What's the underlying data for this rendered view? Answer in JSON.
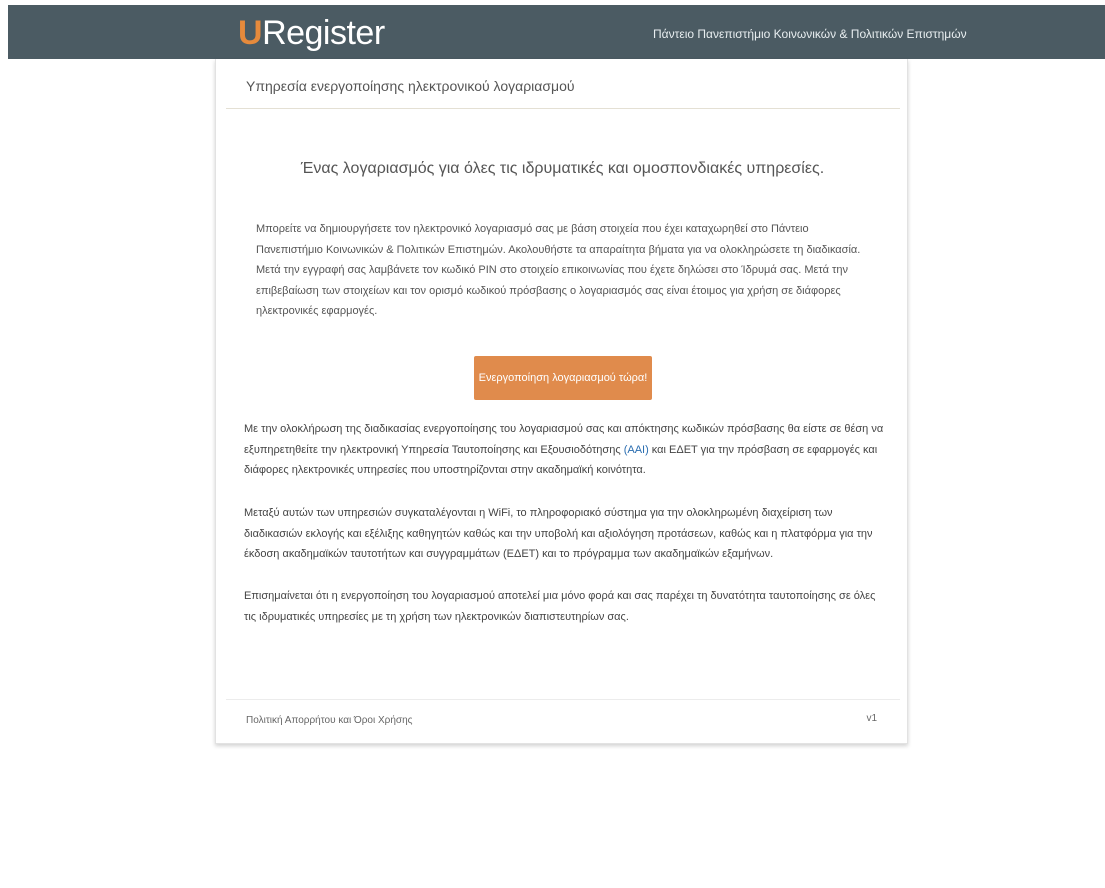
{
  "header": {
    "brand_initial": "U",
    "brand_rest": "Register",
    "institution": "Πάντειο Πανεπιστήμιο Κοινωνικών & Πολιτικών Επιστημών"
  },
  "card": {
    "title": "Υπηρεσία ενεργοποίησης ηλεκτρονικού λογαριασμού",
    "tagline": "Ένας λογαριασμός για όλες τις ιδρυματικές και ομοσπονδιακές υπηρεσίες.",
    "intro": "Μπορείτε να δημιουργήσετε τον ηλεκτρονικό λογαριασμό σας με βάση στοιχεία που έχει καταχωρηθεί στο Πάντειο Πανεπιστήμιο Κοινωνικών & Πολιτικών Επιστημών. Ακολουθήστε τα απαραίτητα βήματα για να ολοκληρώσετε τη διαδικασία. Μετά την εγγραφή σας λαμβάνετε τον κωδικό PIN στο στοιχείο επικοινωνίας που έχετε δηλώσει στο Ίδρυμά σας. Μετά την επιβεβαίωση των στοιχείων και τον ορισμό κωδικού πρόσβασης ο λογαριασμός σας είναι έτοιμος για χρήση σε διάφορες ηλεκτρονικές εφαρμογές.",
    "cta_label": "Ενεργοποίηση λογαριασμού τώρα!",
    "p1_before": "Με την ολοκλήρωση της διαδικασίας ενεργοποίησης του λογαριασμού σας και απόκτησης κωδικών πρόσβασης θα είστε σε θέση να εξυπηρετηθείτε την ηλεκτρονική Υπηρεσία Ταυτοποίησης και Εξουσιοδότησης ",
    "p1_link": "(ΑΑΙ)",
    "p1_after": " και ΕΔΕΤ για την πρόσβαση σε εφαρμογές και διάφορες ηλεκτρονικές υπηρεσίες που υποστηρίζονται στην ακαδημαϊκή κοινότητα.",
    "p2": "Μεταξύ αυτών των υπηρεσιών συγκαταλέγονται η WiFi, το πληροφοριακό σύστημα για την ολοκληρωμένη διαχείριση των διαδικασιών εκλογής και εξέλιξης καθηγητών καθώς και την υποβολή και αξιολόγηση προτάσεων, καθώς και η πλατφόρμα για την έκδοση ακαδημαϊκών ταυτοτήτων και συγγραμμάτων (ΕΔΕΤ) και το πρόγραμμα των ακαδημαϊκών εξαμήνων.",
    "p3": "Επισημαίνεται ότι η ενεργοποίηση του λογαριασμού αποτελεί μια μόνο φορά και σας παρέχει τη δυνατότητα ταυτοποίησης σε όλες τις ιδρυματικές υπηρεσίες με τη χρήση των ηλεκτρονικών διαπιστευτηρίων σας.",
    "footer_left": "Πολιτική Απορρήτου και Όροι Χρήσης",
    "footer_right": "v1"
  },
  "colors": {
    "topbar": "#4b5b63",
    "brand_accent": "#e68a3c",
    "cta": "#e08b4c",
    "link": "#2a6db0"
  }
}
